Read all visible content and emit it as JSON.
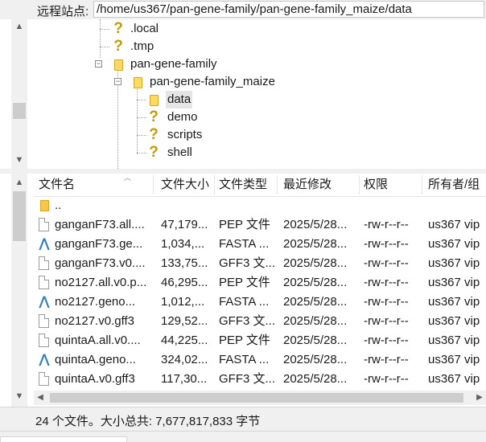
{
  "pathbar": {
    "label": "远程站点:",
    "path": "/home/us367/pan-gene-family/pan-gene-family_maize/data"
  },
  "tree": {
    "items": [
      {
        "name": ".local",
        "icon": "question-icon"
      },
      {
        "name": ".tmp",
        "icon": "question-icon"
      },
      {
        "name": "pan-gene-family",
        "icon": "folder-icon",
        "expanded": true
      },
      {
        "name": "pan-gene-family_maize",
        "icon": "folder-icon",
        "expanded": true
      },
      {
        "name": "data",
        "icon": "folder-icon",
        "selected": true
      },
      {
        "name": "demo",
        "icon": "question-icon"
      },
      {
        "name": "scripts",
        "icon": "question-icon"
      },
      {
        "name": "shell",
        "icon": "question-icon"
      }
    ]
  },
  "files": {
    "columns": [
      "文件名",
      "文件大小",
      "文件类型",
      "最近修改",
      "权限",
      "所有者/组"
    ],
    "parent_dir": "..",
    "rows": [
      {
        "name": "ganganF73.all....",
        "size": "47,179...",
        "type": "PEP 文件",
        "modified": "2025/5/28...",
        "perm": "-rw-r--r--",
        "owner": "us367 vip",
        "icon": "file-icon"
      },
      {
        "name": "ganganF73.ge...",
        "size": "1,034,...",
        "type": "FASTA ...",
        "modified": "2025/5/28...",
        "perm": "-rw-r--r--",
        "owner": "us367 vip",
        "icon": "fasta-icon"
      },
      {
        "name": "ganganF73.v0....",
        "size": "133,75...",
        "type": "GFF3 文...",
        "modified": "2025/5/28...",
        "perm": "-rw-r--r--",
        "owner": "us367 vip",
        "icon": "file-icon"
      },
      {
        "name": "no2127.all.v0.p...",
        "size": "46,295...",
        "type": "PEP 文件",
        "modified": "2025/5/28...",
        "perm": "-rw-r--r--",
        "owner": "us367 vip",
        "icon": "file-icon"
      },
      {
        "name": "no2127.geno...",
        "size": "1,012,...",
        "type": "FASTA ...",
        "modified": "2025/5/28...",
        "perm": "-rw-r--r--",
        "owner": "us367 vip",
        "icon": "fasta-icon"
      },
      {
        "name": "no2127.v0.gff3",
        "size": "129,52...",
        "type": "GFF3 文...",
        "modified": "2025/5/28...",
        "perm": "-rw-r--r--",
        "owner": "us367 vip",
        "icon": "file-icon"
      },
      {
        "name": "quintaA.all.v0....",
        "size": "44,225...",
        "type": "PEP 文件",
        "modified": "2025/5/28...",
        "perm": "-rw-r--r--",
        "owner": "us367 vip",
        "icon": "file-icon"
      },
      {
        "name": "quintaA.geno...",
        "size": "324,02...",
        "type": "FASTA ...",
        "modified": "2025/5/28...",
        "perm": "-rw-r--r--",
        "owner": "us367 vip",
        "icon": "fasta-icon"
      },
      {
        "name": "quintaA.v0.gff3",
        "size": "117,30...",
        "type": "GFF3 文...",
        "modified": "2025/5/28...",
        "perm": "-rw-r--r--",
        "owner": "us367 vip",
        "icon": "file-icon"
      }
    ]
  },
  "status": {
    "text": "24 个文件。大小总共: 7,677,817,833 字节"
  },
  "colors": {
    "folder": "#f5c84c",
    "question": "#c69a00",
    "fasta": "#2f7fbf",
    "selection": "#e5e5e5"
  }
}
